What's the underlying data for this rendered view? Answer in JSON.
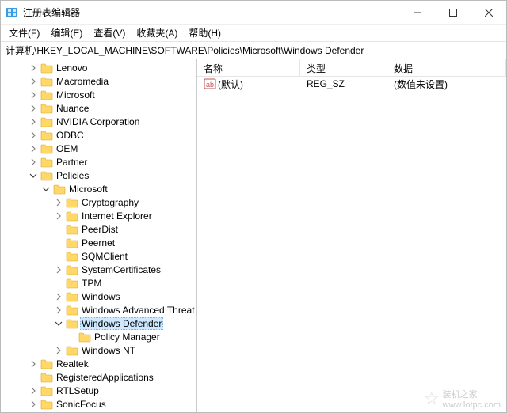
{
  "window": {
    "title": "注册表编辑器"
  },
  "menu": {
    "file": "文件(F)",
    "edit": "编辑(E)",
    "view": "查看(V)",
    "favorites": "收藏夹(A)",
    "help": "帮助(H)"
  },
  "address": {
    "path": "计算机\\HKEY_LOCAL_MACHINE\\SOFTWARE\\Policies\\Microsoft\\Windows Defender"
  },
  "tree": {
    "items": [
      {
        "label": "Lenovo",
        "expandable": true
      },
      {
        "label": "Macromedia",
        "expandable": true
      },
      {
        "label": "Microsoft",
        "expandable": true
      },
      {
        "label": "Nuance",
        "expandable": true
      },
      {
        "label": "NVIDIA Corporation",
        "expandable": true
      },
      {
        "label": "ODBC",
        "expandable": true
      },
      {
        "label": "OEM",
        "expandable": true
      },
      {
        "label": "Partner",
        "expandable": true
      }
    ],
    "policies": {
      "label": "Policies",
      "microsoft": {
        "label": "Microsoft",
        "children": [
          {
            "label": "Cryptography",
            "expandable": true
          },
          {
            "label": "Internet Explorer",
            "expandable": true
          },
          {
            "label": "PeerDist",
            "expandable": false
          },
          {
            "label": "Peernet",
            "expandable": false
          },
          {
            "label": "SQMClient",
            "expandable": false
          },
          {
            "label": "SystemCertificates",
            "expandable": true
          },
          {
            "label": "TPM",
            "expandable": false
          },
          {
            "label": "Windows",
            "expandable": true
          },
          {
            "label": "Windows Advanced Threat Protection",
            "expandable": true
          }
        ],
        "defender": {
          "label": "Windows Defender",
          "child": {
            "label": "Policy Manager"
          }
        },
        "after": [
          {
            "label": "Windows NT",
            "expandable": true
          }
        ]
      }
    },
    "after_policies": [
      {
        "label": "Realtek",
        "expandable": true
      },
      {
        "label": "RegisteredApplications",
        "expandable": false
      },
      {
        "label": "RTLSetup",
        "expandable": true
      },
      {
        "label": "SonicFocus",
        "expandable": true
      }
    ]
  },
  "list": {
    "headers": {
      "name": "名称",
      "type": "类型",
      "data": "数据"
    },
    "rows": [
      {
        "name": "(默认)",
        "type": "REG_SZ",
        "data": "(数值未设置)"
      }
    ]
  },
  "watermark": {
    "text1": "装机之家",
    "text2": "www.lotpc.com"
  }
}
